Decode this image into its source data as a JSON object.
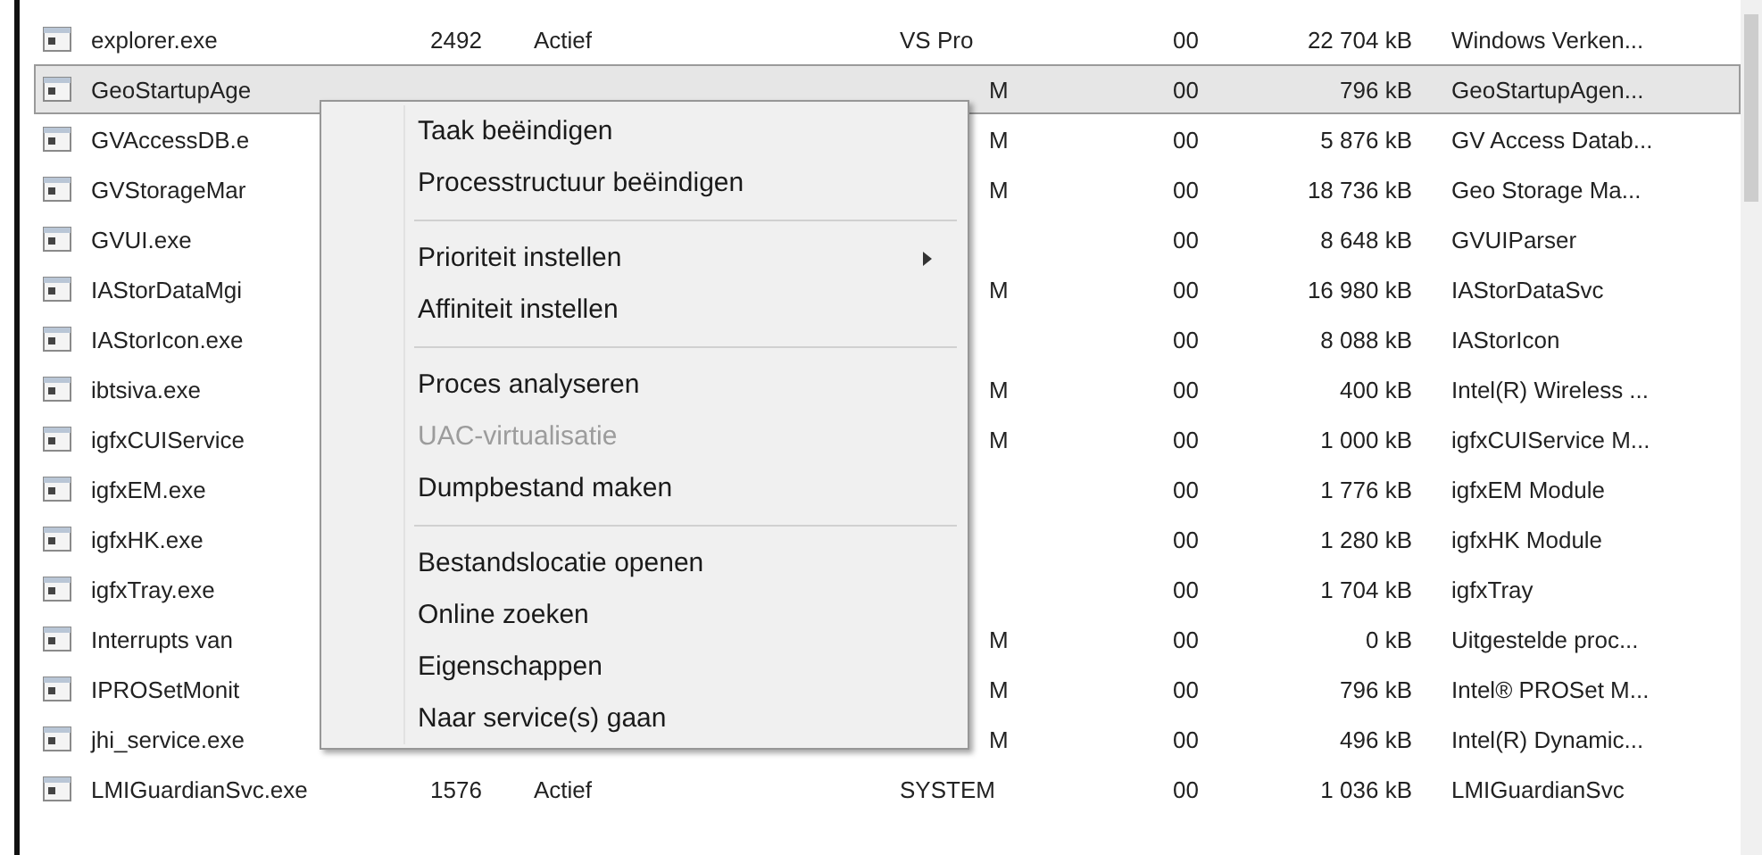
{
  "processes": [
    {
      "name": "explorer.exe",
      "pid": "2492",
      "status": "Actief",
      "user": "VS Pro",
      "cpu": "00",
      "memory": "22 704 kB",
      "description": "Windows Verken...",
      "selected": false
    },
    {
      "name": "GeoStartupAge",
      "cpu": "00",
      "user": "M",
      "memory": "796 kB",
      "description": "GeoStartupAgen...",
      "selected": true
    },
    {
      "name": "GVAccessDB.e",
      "user": "M",
      "cpu": "00",
      "memory": "5 876 kB",
      "description": "GV Access Datab...",
      "selected": false
    },
    {
      "name": "GVStorageMar",
      "user": "M",
      "cpu": "00",
      "memory": "18 736 kB",
      "description": "Geo Storage Ma...",
      "selected": false
    },
    {
      "name": "GVUI.exe",
      "cpu": "00",
      "memory": "8 648 kB",
      "description": "GVUIParser",
      "selected": false
    },
    {
      "name": "IAStorDataMgi",
      "user": "M",
      "cpu": "00",
      "memory": "16 980 kB",
      "description": "IAStorDataSvc",
      "selected": false
    },
    {
      "name": "IAStorIcon.exe",
      "cpu": "00",
      "memory": "8 088 kB",
      "description": "IAStorIcon",
      "selected": false
    },
    {
      "name": "ibtsiva.exe",
      "user": "M",
      "cpu": "00",
      "memory": "400 kB",
      "description": "Intel(R) Wireless ...",
      "selected": false
    },
    {
      "name": "igfxCUIService",
      "user": "M",
      "cpu": "00",
      "memory": "1 000 kB",
      "description": "igfxCUIService M...",
      "selected": false
    },
    {
      "name": "igfxEM.exe",
      "cpu": "00",
      "memory": "1 776 kB",
      "description": "igfxEM Module",
      "selected": false
    },
    {
      "name": "igfxHK.exe",
      "cpu": "00",
      "memory": "1 280 kB",
      "description": "igfxHK Module",
      "selected": false
    },
    {
      "name": "igfxTray.exe",
      "cpu": "00",
      "memory": "1 704 kB",
      "description": "igfxTray",
      "selected": false
    },
    {
      "name": "Interrupts van",
      "user": "M",
      "cpu": "00",
      "memory": "0 kB",
      "description": "Uitgestelde proc...",
      "selected": false
    },
    {
      "name": "IPROSetMonit",
      "user": "M",
      "cpu": "00",
      "memory": "796 kB",
      "description": "Intel® PROSet M...",
      "selected": false
    },
    {
      "name": "jhi_service.exe",
      "user": "M",
      "cpu": "00",
      "memory": "496 kB",
      "description": "Intel(R) Dynamic...",
      "selected": false
    },
    {
      "name": "LMIGuardianSvc.exe",
      "pid": "1576",
      "status": "Actief",
      "user": "SYSTEM",
      "cpu": "00",
      "memory": "1 036 kB",
      "description": "LMIGuardianSvc",
      "selected": false
    }
  ],
  "context_menu": [
    {
      "kind": "item",
      "label": "Taak beëindigen",
      "disabled": false,
      "submenu": false
    },
    {
      "kind": "item",
      "label": "Processtructuur beëindigen",
      "disabled": false,
      "submenu": false
    },
    {
      "kind": "separator"
    },
    {
      "kind": "item",
      "label": "Prioriteit instellen",
      "disabled": false,
      "submenu": true
    },
    {
      "kind": "item",
      "label": "Affiniteit instellen",
      "disabled": false,
      "submenu": false
    },
    {
      "kind": "separator"
    },
    {
      "kind": "item",
      "label": "Proces analyseren",
      "disabled": false,
      "submenu": false
    },
    {
      "kind": "item",
      "label": "UAC-virtualisatie",
      "disabled": true,
      "submenu": false
    },
    {
      "kind": "item",
      "label": "Dumpbestand maken",
      "disabled": false,
      "submenu": false
    },
    {
      "kind": "separator"
    },
    {
      "kind": "item",
      "label": "Bestandslocatie openen",
      "disabled": false,
      "submenu": false
    },
    {
      "kind": "item",
      "label": "Online zoeken",
      "disabled": false,
      "submenu": false
    },
    {
      "kind": "item",
      "label": "Eigenschappen",
      "disabled": false,
      "submenu": false
    },
    {
      "kind": "item",
      "label": "Naar service(s) gaan",
      "disabled": false,
      "submenu": false
    }
  ]
}
